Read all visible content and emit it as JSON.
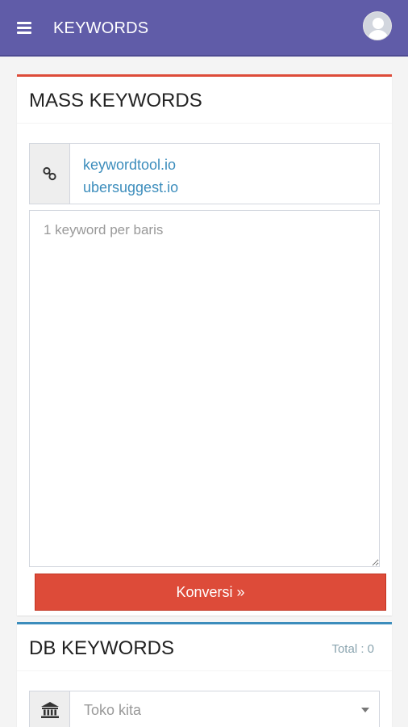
{
  "header": {
    "title": "KEYWORDS",
    "menu_icon": "hamburger-menu-icon",
    "avatar_icon": "user-avatar-icon"
  },
  "mass_keywords": {
    "title": "MASS KEYWORDS",
    "accent_color": "#dd4b39",
    "link_icon": "chain-link-icon",
    "links": [
      "keywordtool.io",
      "ubersuggest.io"
    ],
    "textarea": {
      "placeholder": "1 keyword per baris",
      "value": ""
    },
    "convert_button": "Konversi »"
  },
  "db_keywords": {
    "title": "DB KEYWORDS",
    "accent_color": "#3c8dbc",
    "total": "Total : 0",
    "store_icon": "bank-icon",
    "store_select": {
      "selected": "Toko kita"
    }
  }
}
